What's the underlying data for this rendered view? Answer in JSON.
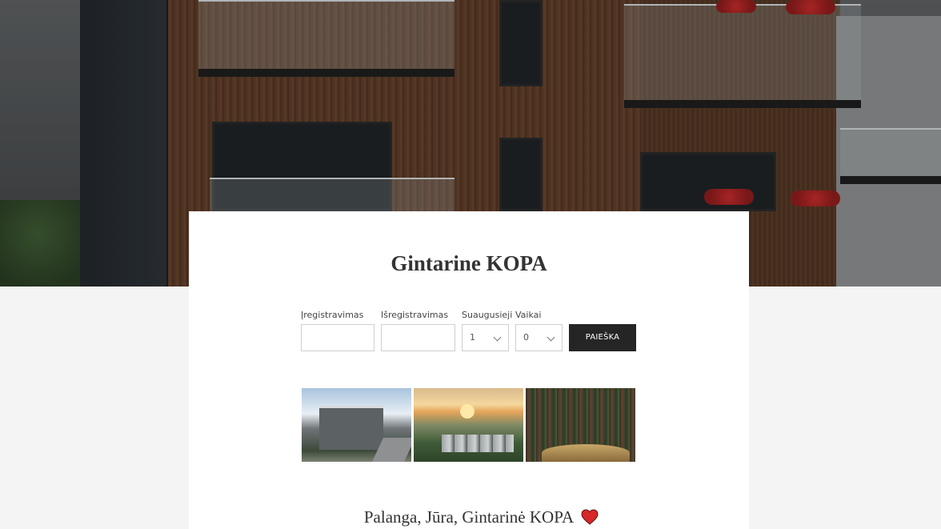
{
  "hotel": {
    "name": "Gintarine KOPA",
    "tagline": "Palanga, Jūra, Gintarinė KOPA"
  },
  "search": {
    "checkin_label": "Įregistravimas",
    "checkin_value": "",
    "checkout_label": "Išregistravimas",
    "checkout_value": "",
    "adults_label": "Suaugusieji",
    "adults_value": "1",
    "children_label": "Vaikai",
    "children_value": "0",
    "submit_label": "PAIEŠKA"
  },
  "gallery": {
    "images": [
      "building-photo",
      "sunset-aerial-photo",
      "forest-path-photo"
    ]
  },
  "colors": {
    "button_bg": "#252525",
    "heart": "#d62828",
    "page_bg": "#f4f4f4"
  },
  "icons": {
    "heart": "heart-icon",
    "dropdown": "chevron-down-icon"
  }
}
